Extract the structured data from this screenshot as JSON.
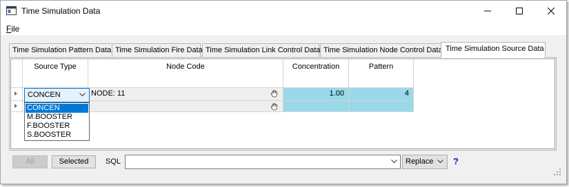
{
  "window": {
    "title": "Time Simulation Data",
    "icon": "app-window-icon"
  },
  "menu": {
    "file_prefix": "F",
    "file_rest": "ile"
  },
  "tabs": [
    {
      "label": "Time Simulation Pattern Data",
      "active": false
    },
    {
      "label": "Time Simulation Fire Data",
      "active": false
    },
    {
      "label": "Time Simulation Link Control Data",
      "active": false
    },
    {
      "label": "Time Simulation Node Control Data",
      "active": false
    },
    {
      "label": "Time Simulation Source Data",
      "active": true
    }
  ],
  "grid": {
    "columns": [
      "Source Type",
      "Node Code",
      "Concentration",
      "Pattern"
    ],
    "rows": [
      {
        "source_type": "CONCEN",
        "node_code": "NODE: 11",
        "concentration": "1.00",
        "pattern": "4"
      },
      {
        "source_type": "",
        "node_code": "",
        "concentration": "",
        "pattern": ""
      }
    ],
    "dropdown_options": [
      "CONCEN",
      "M.BOOSTER",
      "F.BOOSTER",
      "S.BOOSTER"
    ],
    "selected_option": "CONCEN"
  },
  "bottom": {
    "all_label": "All",
    "selected_label": "Selected",
    "sql_label": "SQL",
    "sql_value": "",
    "replace_value": "Replace",
    "help": "?"
  },
  "colors": {
    "numeric_cell": "#99d9ea",
    "selection": "#0078d7",
    "help": "#1a1aa6"
  }
}
